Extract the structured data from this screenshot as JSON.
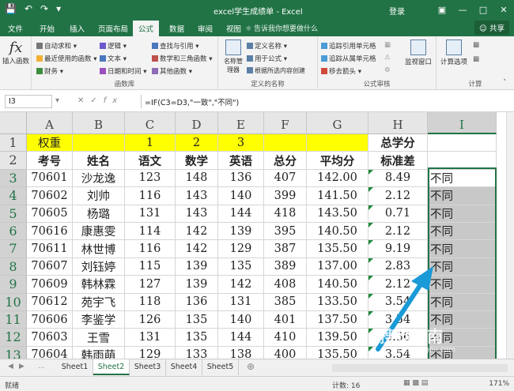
{
  "window": {
    "title": "excel学生成绩单 - Excel",
    "signin": "登录",
    "share": "共享",
    "tell_me": "告诉我你想要做什么"
  },
  "tabs": [
    "文件",
    "开始",
    "插入",
    "页面布局",
    "公式",
    "数据",
    "审阅",
    "视图"
  ],
  "active_tab": "公式",
  "ribbon": {
    "insert_function": "插入函数",
    "library": [
      "自动求和",
      "最近使用的函数",
      "财务",
      "逻辑",
      "文本",
      "日期和时间",
      "查找与引用",
      "数学和三角函数",
      "其他函数"
    ],
    "library_label": "函数库",
    "name_manager": "名称管理器",
    "names": [
      "定义名称",
      "用于公式",
      "根据所选内容创建"
    ],
    "names_label": "定义的名称",
    "audit": [
      "追踪引用单元格",
      "追踪从属单元格",
      "移去箭头"
    ],
    "audit_label": "公式审核",
    "watch": "监视窗口",
    "calc": "计算选项",
    "calc_label": "计算"
  },
  "formula_bar": {
    "name_box": "I3",
    "formula": "=IF(C3=D3,\"一致\",\"不同\")"
  },
  "columns": [
    "A",
    "B",
    "C",
    "D",
    "E",
    "F",
    "G",
    "H",
    "I"
  ],
  "row_numbers": [
    "1",
    "2",
    "3",
    "4",
    "5",
    "6",
    "7",
    "8",
    "9",
    "10",
    "11",
    "12",
    "13"
  ],
  "row1": [
    "权重",
    "",
    "1",
    "2",
    "3",
    "",
    "",
    "总学分",
    ""
  ],
  "row2": [
    "考号",
    "姓名",
    "语文",
    "数学",
    "英语",
    "总分",
    "平均分",
    "标准差",
    ""
  ],
  "rows": [
    [
      "70601",
      "沙龙逸",
      "123",
      "148",
      "136",
      "407",
      "142.00",
      "8.49",
      "不同"
    ],
    [
      "70602",
      "刘帅",
      "116",
      "143",
      "140",
      "399",
      "141.50",
      "2.12",
      "不同"
    ],
    [
      "70605",
      "杨璐",
      "131",
      "143",
      "144",
      "418",
      "143.50",
      "0.71",
      "不同"
    ],
    [
      "70616",
      "康惠雯",
      "114",
      "142",
      "139",
      "395",
      "140.50",
      "2.12",
      "不同"
    ],
    [
      "70611",
      "林世博",
      "116",
      "142",
      "129",
      "387",
      "135.50",
      "9.19",
      "不同"
    ],
    [
      "70607",
      "刘钰婷",
      "115",
      "139",
      "135",
      "389",
      "137.00",
      "2.83",
      "不同"
    ],
    [
      "70609",
      "韩林霖",
      "127",
      "139",
      "142",
      "408",
      "140.50",
      "2.12",
      "不同"
    ],
    [
      "70612",
      "苑宇飞",
      "118",
      "136",
      "131",
      "385",
      "133.50",
      "3.54",
      "不同"
    ],
    [
      "70606",
      "李鉴学",
      "126",
      "135",
      "140",
      "401",
      "137.50",
      "3.54",
      "不同"
    ],
    [
      "70603",
      "王雪",
      "131",
      "135",
      "144",
      "410",
      "139.50",
      "3.36",
      "不同"
    ],
    [
      "70604",
      "韩雨萌",
      "129",
      "133",
      "138",
      "400",
      "135.50",
      "3.54",
      "不同"
    ]
  ],
  "sheets": [
    "Sheet1",
    "Sheet2",
    "Sheet3",
    "Sheet4",
    "Sheet5"
  ],
  "active_sheet": "Sheet2",
  "status": {
    "ready": "就绪",
    "count": "计数: 16",
    "zoom": "171%"
  },
  "watermark": {
    "brand": "搜狗指南",
    "url": "zhinan.sogou.com"
  },
  "colors": {
    "excel_green": "#217346",
    "highlight": "#ffff00",
    "arrow": "#1a9ad6"
  }
}
